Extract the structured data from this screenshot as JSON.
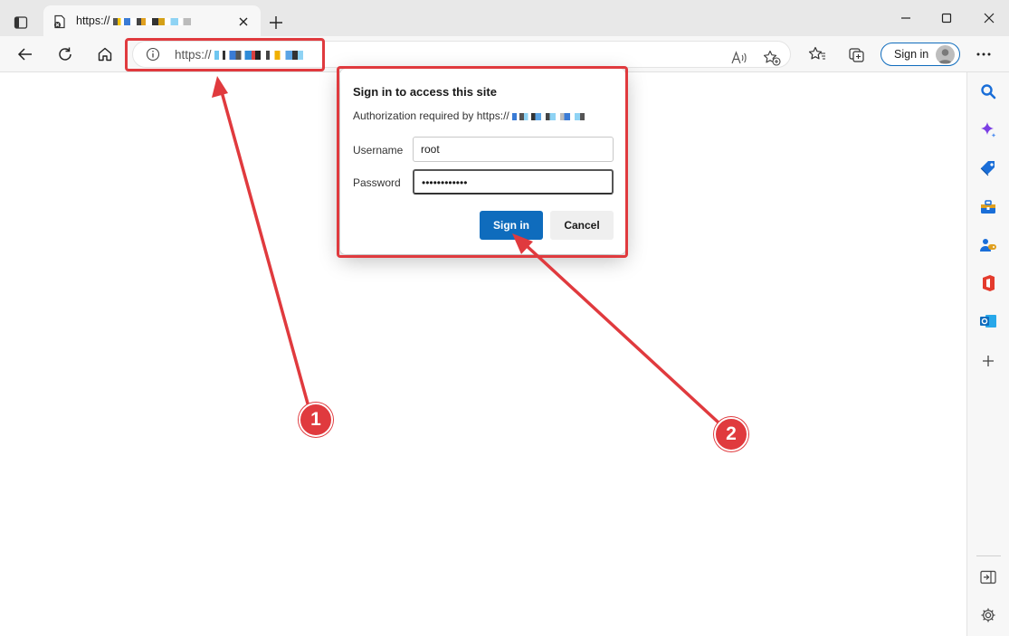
{
  "browser": {
    "tab": {
      "title": "https://",
      "close_icon": "close-icon"
    },
    "address_bar": {
      "url_prefix": "https://"
    },
    "profile": {
      "sign_in_label": "Sign in"
    }
  },
  "dialog": {
    "title": "Sign in to access this site",
    "subtitle_prefix": "Authorization required by https://",
    "username_label": "Username",
    "username_value": "root",
    "password_label": "Password",
    "password_value": "••••••••••••",
    "sign_in_button": "Sign in",
    "cancel_button": "Cancel"
  },
  "annotations": {
    "step1": "1",
    "step2": "2",
    "accent_color": "#e03a3e"
  },
  "colors": {
    "primary_button": "#0f6cbd",
    "chrome_bg": "#f7f7f7",
    "tabstrip_bg": "#e8e8e8"
  }
}
